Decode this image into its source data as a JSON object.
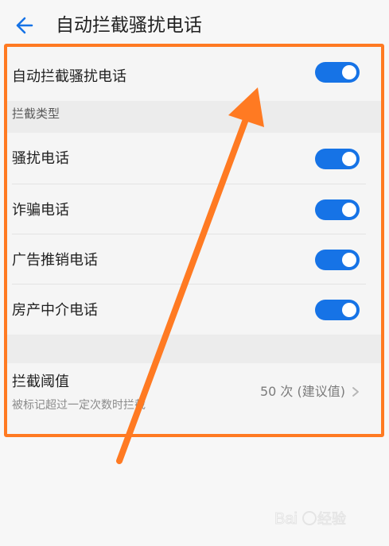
{
  "header": {
    "title": "自动拦截骚扰电话",
    "back_icon": "arrow-left-icon"
  },
  "main": {
    "auto_block": {
      "label": "自动拦截骚扰电话",
      "enabled": true
    },
    "section_title": "拦截类型",
    "types": [
      {
        "label": "骚扰电话",
        "enabled": true
      },
      {
        "label": "诈骗电话",
        "enabled": true
      },
      {
        "label": "广告推销电话",
        "enabled": true
      },
      {
        "label": "房产中介电话",
        "enabled": true
      }
    ],
    "threshold": {
      "title": "拦截阈值",
      "subtitle": "被标记超过一定次数时拦截",
      "value": "50 次 (建议值)"
    }
  },
  "colors": {
    "toggle_on": "#1673e6",
    "highlight": "#ff7a22"
  },
  "watermark": {
    "brand": "Baidu",
    "suffix": "经验"
  }
}
